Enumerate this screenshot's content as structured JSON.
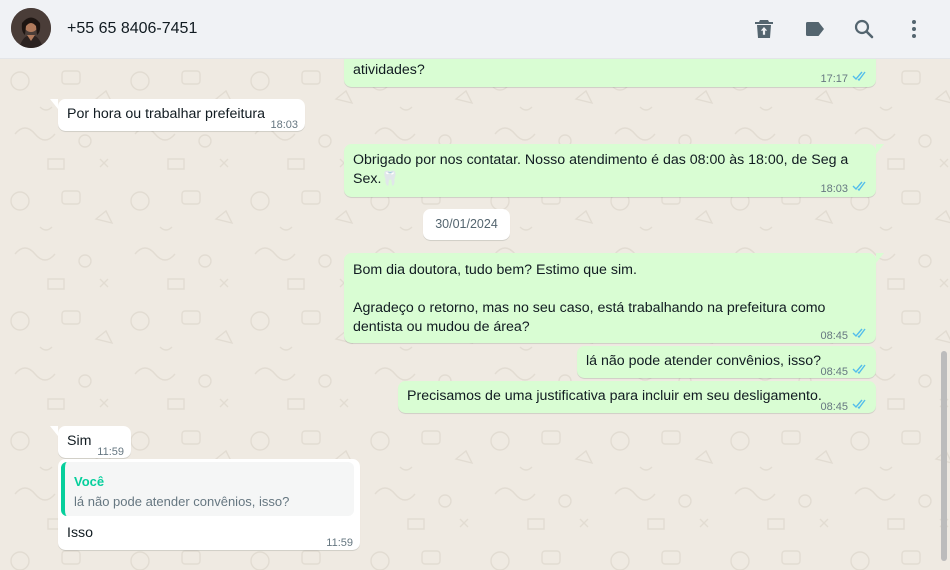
{
  "header": {
    "contact_name": "+55 65 8406-7451",
    "icons": [
      "trash-icon",
      "label-icon",
      "search-icon",
      "menu-icon"
    ]
  },
  "colors": {
    "outgoing_bubble": "#d9fdd3",
    "incoming_bubble": "#ffffff",
    "chat_background": "#efeae2",
    "read_ticks": "#53bdeb",
    "quote_accent": "#06cf9c"
  },
  "messages": [
    {
      "direction": "out",
      "text": "atividades?",
      "time": "17:17",
      "status": "read"
    },
    {
      "direction": "in",
      "text": "Por hora ou trabalhar prefeitura",
      "time": "18:03"
    },
    {
      "direction": "out",
      "text": "Obrigado por nos contatar. Nosso atendimento é das 08:00 às 18:00, de Seg a\nSex.🦷",
      "time": "18:03",
      "status": "read"
    },
    {
      "direction": "out",
      "text": "Bom dia doutora, tudo bem? Estimo que sim.\n\nAgradeço o retorno, mas no seu caso, está trabalhando na prefeitura como\ndentista ou mudou de área?",
      "time": "08:45",
      "status": "read"
    },
    {
      "direction": "out",
      "text": "lá não pode atender convênios, isso?",
      "time": "08:45",
      "status": "read"
    },
    {
      "direction": "out",
      "text": "Precisamos de uma justificativa para incluir em seu desligamento.",
      "time": "08:45",
      "status": "read"
    },
    {
      "direction": "in",
      "text": "Sim",
      "time": "11:59"
    },
    {
      "direction": "in",
      "text": "Isso",
      "time": "11:59",
      "quote": {
        "author": "Você",
        "text": "lá não pode atender convênios, isso?"
      }
    }
  ],
  "date_divider": "30/01/2024"
}
